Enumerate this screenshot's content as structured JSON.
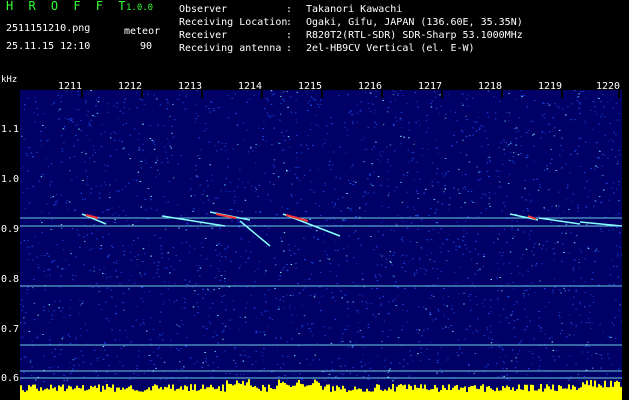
{
  "header": {
    "brand": "H R O F F T",
    "version": "1.0.0",
    "filename": "2511151210.png",
    "datetime": "25.11.15 12:10",
    "meteor_label": "meteor",
    "meteor_count": "90",
    "fields": [
      {
        "label": "Observer",
        "value": "Takanori Kawachi"
      },
      {
        "label": "Receiving Location",
        "value": "Ogaki, Gifu, JAPAN (136.60E, 35.35N)"
      },
      {
        "label": "Receiver",
        "value": "R820T2(RTL-SDR) SDR-Sharp 53.1000MHz"
      },
      {
        "label": "Receiving antenna",
        "value": "2el-HB9CV Vertical (el. E-W)"
      }
    ],
    "separator": ":"
  },
  "spectrogram": {
    "unit": "kHz",
    "x_ticks": [
      "1211",
      "1212",
      "1213",
      "1214",
      "1215",
      "1216",
      "1217",
      "1218",
      "1219",
      "1220"
    ],
    "y_ticks": [
      "1.1",
      "1.0",
      "0.9",
      "0.8",
      "0.7",
      "0.6"
    ],
    "colors": {
      "background": "#000066",
      "noise": "#2255ff",
      "line": "#88ffff",
      "echo": "#ff3333",
      "level": "#ffff00"
    }
  }
}
